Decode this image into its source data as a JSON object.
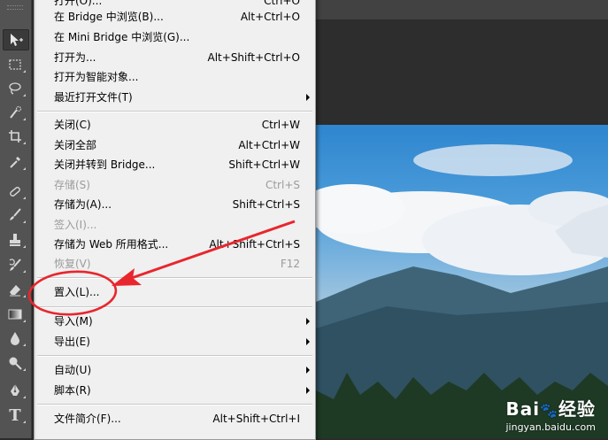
{
  "file_menu": {
    "items": [
      {
        "label": "打开(O)...",
        "shortcut": "Ctrl+O",
        "enabled": true
      },
      {
        "label": "在 Bridge 中浏览(B)...",
        "shortcut": "Alt+Ctrl+O",
        "enabled": true
      },
      {
        "label": "在 Mini Bridge 中浏览(G)...",
        "shortcut": "",
        "enabled": true
      },
      {
        "label": "打开为...",
        "shortcut": "Alt+Shift+Ctrl+O",
        "enabled": true
      },
      {
        "label": "打开为智能对象...",
        "shortcut": "",
        "enabled": true
      },
      {
        "label": "最近打开文件(T)",
        "shortcut": "",
        "enabled": true,
        "submenu": true
      },
      {
        "label": "关闭(C)",
        "shortcut": "Ctrl+W",
        "enabled": true
      },
      {
        "label": "关闭全部",
        "shortcut": "Alt+Ctrl+W",
        "enabled": true
      },
      {
        "label": "关闭并转到 Bridge...",
        "shortcut": "Shift+Ctrl+W",
        "enabled": true
      },
      {
        "label": "存储(S)",
        "shortcut": "Ctrl+S",
        "enabled": false
      },
      {
        "label": "存储为(A)...",
        "shortcut": "Shift+Ctrl+S",
        "enabled": true
      },
      {
        "label": "签入(I)...",
        "shortcut": "",
        "enabled": false
      },
      {
        "label": "存储为 Web 所用格式...",
        "shortcut": "Alt+Shift+Ctrl+S",
        "enabled": true
      },
      {
        "label": "恢复(V)",
        "shortcut": "F12",
        "enabled": false
      },
      {
        "label": "置入(L)...",
        "shortcut": "",
        "enabled": true
      },
      {
        "label": "导入(M)",
        "shortcut": "",
        "enabled": true,
        "submenu": true
      },
      {
        "label": "导出(E)",
        "shortcut": "",
        "enabled": true,
        "submenu": true
      },
      {
        "label": "自动(U)",
        "shortcut": "",
        "enabled": true,
        "submenu": true
      },
      {
        "label": "脚本(R)",
        "shortcut": "",
        "enabled": true,
        "submenu": true
      },
      {
        "label": "文件简介(F)...",
        "shortcut": "Alt+Shift+Ctrl+I",
        "enabled": true
      }
    ]
  },
  "toolbar": {
    "tools": [
      "move-tool-icon",
      "marquee-tool-icon",
      "lasso-tool-icon",
      "quick-selection-tool-icon",
      "crop-tool-icon",
      "eyedropper-tool-icon",
      "healing-brush-tool-icon",
      "brush-tool-icon",
      "clone-stamp-tool-icon",
      "history-brush-tool-icon",
      "eraser-tool-icon",
      "gradient-tool-icon",
      "blur-tool-icon",
      "dodge-tool-icon",
      "pen-tool-icon",
      "type-tool-icon"
    ],
    "type_tool_glyph": "T"
  },
  "watermark": {
    "brand_left": "Bai",
    "brand_right": "经验",
    "url": "jingyan.baidu.com"
  },
  "colors": {
    "annotation_red": "#e8262d",
    "menu_bg": "#f0f0f0",
    "disabled_text": "#9b9b9b"
  }
}
